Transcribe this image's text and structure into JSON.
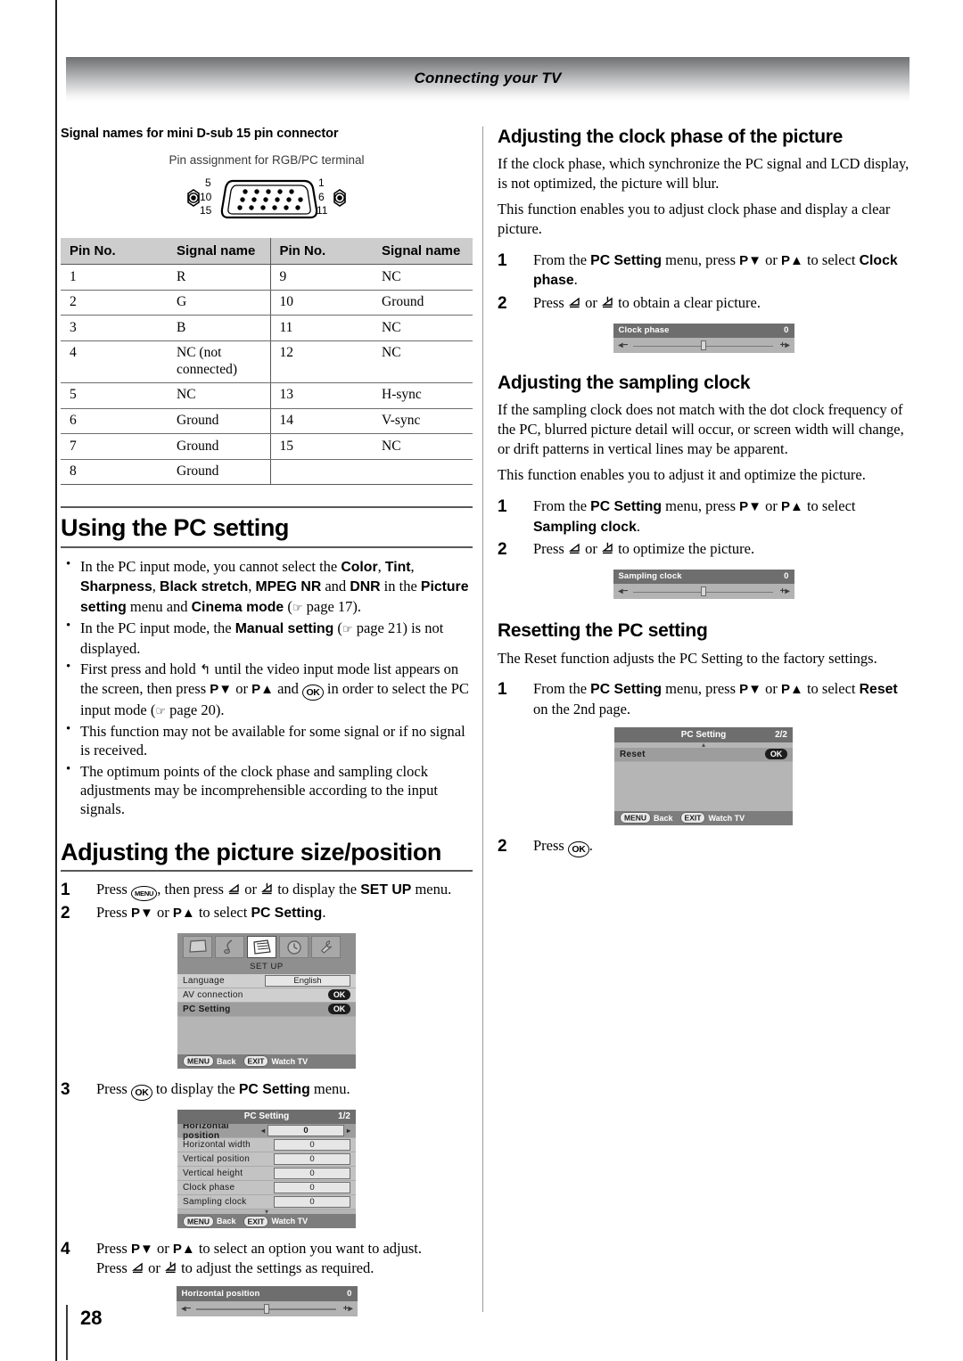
{
  "header": {
    "title": "Connecting your TV"
  },
  "page": {
    "number": "28"
  },
  "left": {
    "signal_section": {
      "heading": "Signal names for mini D-sub 15 pin connector",
      "caption": "Pin assignment for RGB/PC terminal",
      "connector_labels": {
        "top_left": "5",
        "mid_left": "10",
        "bottom_left": "15",
        "top_right": "1",
        "mid_right": "6",
        "bottom_right": "11"
      },
      "table": {
        "headers": [
          "Pin No.",
          "Signal name",
          "Pin No.",
          "Signal name"
        ],
        "rows": [
          [
            "1",
            "R",
            "9",
            "NC"
          ],
          [
            "2",
            "G",
            "10",
            "Ground"
          ],
          [
            "3",
            "B",
            "11",
            "NC"
          ],
          [
            "4",
            "NC (not connected)",
            "12",
            "NC"
          ],
          [
            "5",
            "NC",
            "13",
            "H-sync"
          ],
          [
            "6",
            "Ground",
            "14",
            "V-sync"
          ],
          [
            "7",
            "Ground",
            "15",
            "NC"
          ],
          [
            "8",
            "Ground",
            "",
            ""
          ]
        ]
      }
    },
    "using_pc": {
      "heading": "Using the PC setting",
      "bullets": [
        "In the PC input mode, you cannot select the Color, Tint, Sharpness, Black stretch, MPEG NR and DNR in the Picture setting menu and Cinema mode (☞ page 17).",
        "In the PC input mode, the Manual setting (☞ page 21) is not displayed.",
        "First press and hold ↶ until the video input mode list appears on the screen, then press P▼ or P▲ and (OK) in order to select the PC input mode (☞ page 20).",
        "This function may not be available for some signal or if no signal is received.",
        "The optimum points of the clock phase and sampling clock adjustments may be incomprehensible according to the input signals."
      ]
    },
    "picture_size": {
      "heading": "Adjusting the picture size/position",
      "steps": [
        {
          "num": "1",
          "text": "Press (MENU), then press ◁ or ▷ to display the SET UP menu."
        },
        {
          "num": "2",
          "text": "Press P▼ or P▲ to select PC Setting."
        },
        {
          "num": "3",
          "text": "Press (OK) to display the PC Setting menu."
        },
        {
          "num": "4",
          "text": "Press P▼ or P▲ to select an option you want to adjust. Press ◁ or ▷ to adjust the settings as required."
        }
      ],
      "setup_menu": {
        "icons": [
          "picture-icon",
          "sound-icon",
          "setup-icon",
          "timer-icon",
          "tools-icon"
        ],
        "selected_icon_index": 2,
        "title": "SET UP",
        "rows": [
          {
            "label": "Language",
            "value": "English",
            "type": "value"
          },
          {
            "label": "AV connection",
            "value": "OK",
            "type": "ok"
          },
          {
            "label": "PC Setting",
            "value": "OK",
            "type": "ok",
            "selected": true
          }
        ],
        "footer": [
          {
            "key": "MENU",
            "label": "Back"
          },
          {
            "key": "EXIT",
            "label": "Watch TV"
          }
        ]
      },
      "pc_setting_menu": {
        "title": "PC Setting",
        "page": "1/2",
        "rows": [
          {
            "label": "Horizontal position",
            "value": "0",
            "selected": true
          },
          {
            "label": "Horizontal width",
            "value": "0"
          },
          {
            "label": "Vertical position",
            "value": "0"
          },
          {
            "label": "Vertical height",
            "value": "0"
          },
          {
            "label": "Clock phase",
            "value": "0"
          },
          {
            "label": "Sampling clock",
            "value": "0"
          }
        ],
        "footer": [
          {
            "key": "MENU",
            "label": "Back"
          },
          {
            "key": "EXIT",
            "label": "Watch TV"
          }
        ]
      },
      "slider": {
        "label": "Horizontal position",
        "value": "0",
        "minus": "◂−",
        "plus": "+▸"
      }
    }
  },
  "right": {
    "clock_phase": {
      "heading": "Adjusting the clock phase of the picture",
      "paragraphs": [
        "If the clock phase, which synchronize the PC signal and LCD display, is not optimized, the picture will blur.",
        "This function enables you to adjust clock phase and display a clear picture."
      ],
      "steps": [
        {
          "num": "1",
          "text": "From the PC Setting menu, press P▼ or P▲ to select Clock phase."
        },
        {
          "num": "2",
          "text": "Press ◁ or ▷ to obtain a clear picture."
        }
      ],
      "slider": {
        "label": "Clock phase",
        "value": "0",
        "minus": "◂−",
        "plus": "+▸"
      }
    },
    "sampling_clock": {
      "heading": "Adjusting the sampling clock",
      "paragraphs": [
        "If the sampling clock does not match with the dot clock frequency of the PC, blurred picture detail will occur, or screen width will change, or drift patterns in vertical lines may be apparent.",
        "This function enables you to adjust it and optimize the picture."
      ],
      "steps": [
        {
          "num": "1",
          "text": "From the PC Setting menu, press P▼ or P▲ to select Sampling clock."
        },
        {
          "num": "2",
          "text": "Press ◁ or ▷ to optimize the picture."
        }
      ],
      "slider": {
        "label": "Sampling clock",
        "value": "0",
        "minus": "◂−",
        "plus": "+▸"
      }
    },
    "resetting": {
      "heading": "Resetting the PC setting",
      "paragraphs": [
        "The Reset function adjusts the PC Setting to the factory settings."
      ],
      "steps": [
        {
          "num": "1",
          "text": "From the PC Setting menu, press P▼ or P▲ to select Reset on the 2nd page."
        },
        {
          "num": "2",
          "text": "Press (OK)."
        }
      ],
      "reset_menu": {
        "title": "PC Setting",
        "page": "2/2",
        "rows": [
          {
            "label": "Reset",
            "value": "OK",
            "selected": true
          }
        ],
        "footer": [
          {
            "key": "MENU",
            "label": "Back"
          },
          {
            "key": "EXIT",
            "label": "Watch TV"
          }
        ]
      }
    }
  }
}
